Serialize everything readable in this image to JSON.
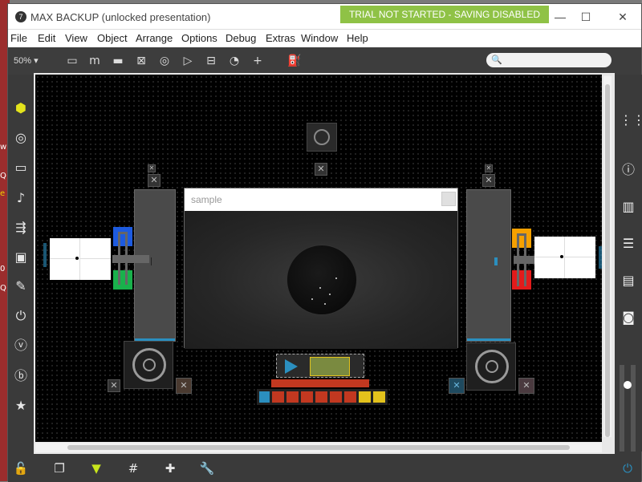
{
  "window": {
    "title": "MAX BACKUP (unlocked presentation)",
    "trial_badge": "TRIAL NOT STARTED - SAVING DISABLED",
    "controls": {
      "minimize": "—",
      "maximize": "☐",
      "close": "✕"
    }
  },
  "menu": [
    "File",
    "Edit",
    "View",
    "Object",
    "Arrange",
    "Options",
    "Debug",
    "Extras",
    "Window",
    "Help"
  ],
  "toolbar": {
    "zoom": "50%",
    "tools": [
      "new-object-icon",
      "message-icon",
      "comment-icon",
      "toggle-icon",
      "button-icon",
      "playbar-icon",
      "slider-icon",
      "dial-icon",
      "plus-icon",
      "paint-bucket-icon"
    ],
    "search_placeholder": ""
  },
  "left_sidebar": [
    "cube-icon",
    "target-icon",
    "bus-icon",
    "music-note-icon",
    "step-sequencer-icon",
    "image-icon",
    "paperclip-icon",
    "plug-icon",
    "vimeo-icon",
    "b-icon",
    "star-icon"
  ],
  "right_sidebar": [
    "grid-dots-icon",
    "info-icon",
    "book-icon",
    "list-icon",
    "open-book-icon",
    "camera-icon"
  ],
  "bottom_bar": [
    "unlock-icon",
    "stack-icon",
    "presentation-icon",
    "grid-icon",
    "debug-icon",
    "wrench-icon",
    "power-icon"
  ],
  "patch": {
    "sample_window_title": "sample",
    "colors": {
      "blue": "#1d5be0",
      "green": "#19b14c",
      "orange": "#f5a000",
      "red": "#e21b1b",
      "yellow": "#e3c21c",
      "accent": "#8fc246",
      "cyan": "#2b8fbf"
    }
  },
  "background_strip": [
    "w",
    "Q",
    "e",
    "0",
    "Q"
  ]
}
